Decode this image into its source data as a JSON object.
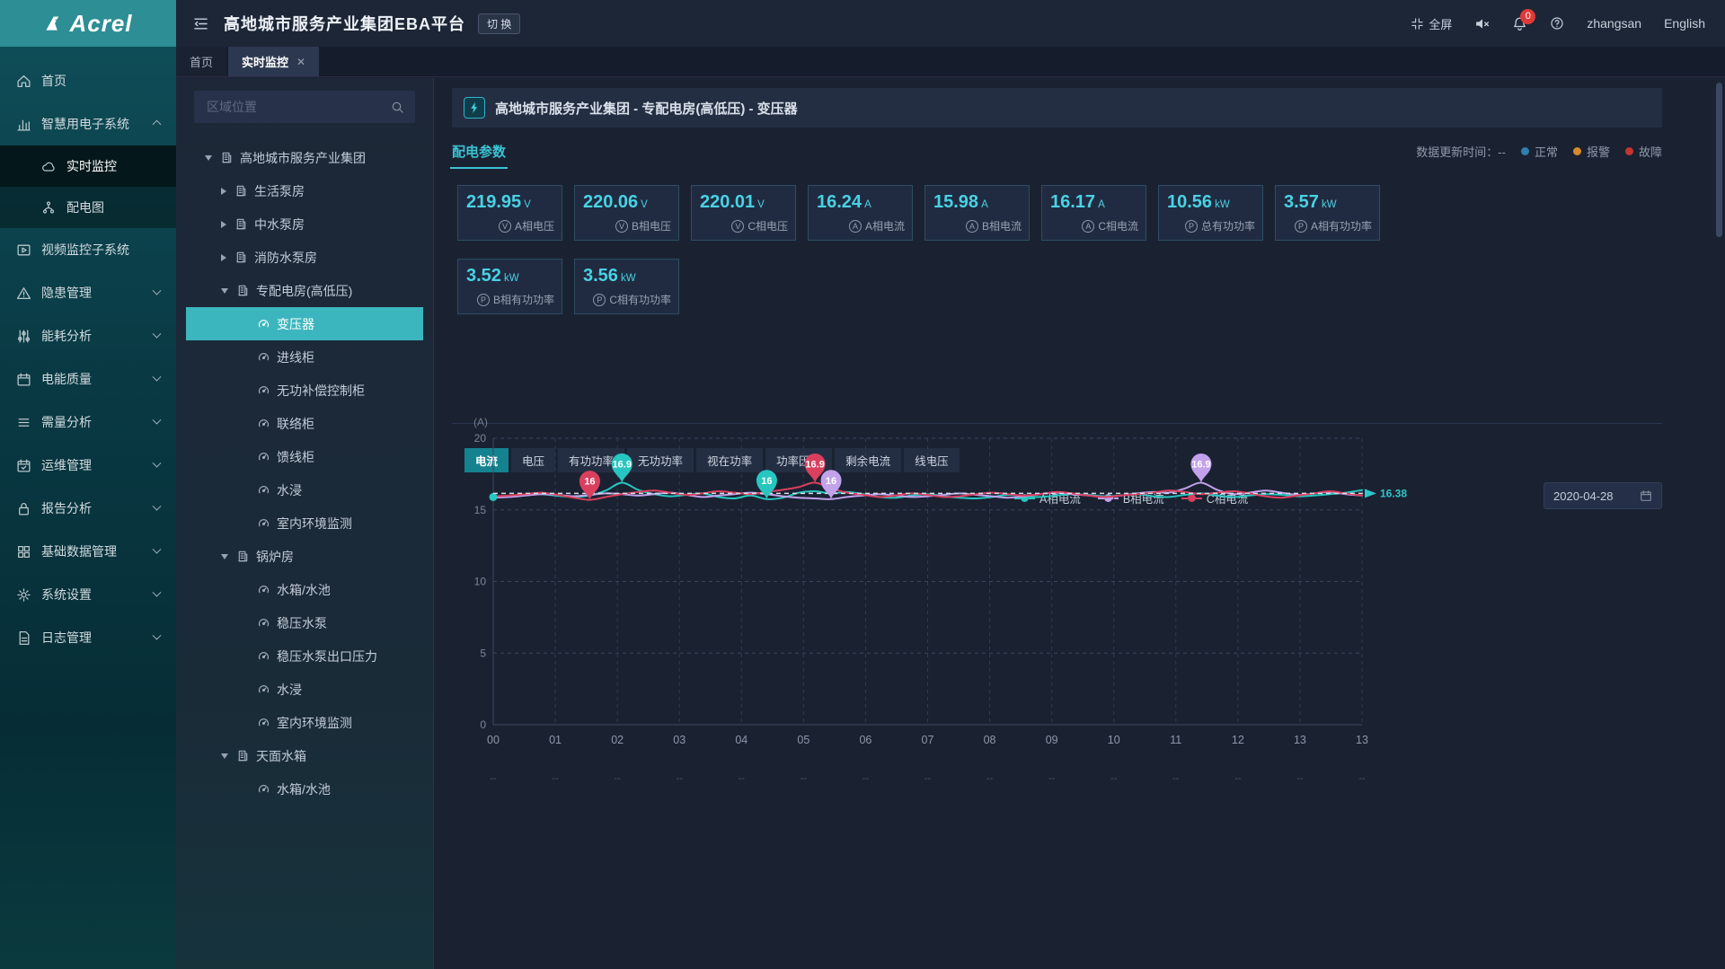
{
  "app": {
    "logo_text": "Acrel",
    "title": "高地城市服务产业集团EBA平台",
    "switch_button": "切 换"
  },
  "header": {
    "fullscreen_label": "全屏",
    "notification_count": "0",
    "username": "zhangsan",
    "language": "English"
  },
  "tabs": [
    {
      "label": "首页",
      "active": false,
      "closable": false
    },
    {
      "label": "实时监控",
      "active": true,
      "closable": true,
      "close_glyph": "✕"
    }
  ],
  "sidebar": {
    "items": [
      {
        "icon": "home",
        "label": "首页"
      },
      {
        "icon": "bar-chart",
        "label": "智慧用电子系统",
        "chevron": "up",
        "children": [
          {
            "icon": "cloud",
            "label": "实时监控",
            "active": true
          },
          {
            "icon": "branch",
            "label": "配电图"
          }
        ]
      },
      {
        "icon": "video",
        "label": "视频监控子系统"
      },
      {
        "icon": "warning",
        "label": "隐患管理",
        "chevron": "down"
      },
      {
        "icon": "sliders",
        "label": "能耗分析",
        "chevron": "down"
      },
      {
        "icon": "calendar",
        "label": "电能质量",
        "chevron": "down"
      },
      {
        "icon": "list",
        "label": "需量分析",
        "chevron": "down"
      },
      {
        "icon": "calendar-check",
        "label": "运维管理",
        "chevron": "down"
      },
      {
        "icon": "lock",
        "label": "报告分析",
        "chevron": "down"
      },
      {
        "icon": "grid",
        "label": "基础数据管理",
        "chevron": "down"
      },
      {
        "icon": "gear",
        "label": "系统设置",
        "chevron": "down"
      },
      {
        "icon": "file",
        "label": "日志管理",
        "chevron": "down"
      }
    ]
  },
  "tree": {
    "search_placeholder": "区域位置",
    "nodes": [
      {
        "level": 0,
        "caret": "down",
        "icon": "building",
        "label": "高地城市服务产业集团"
      },
      {
        "level": 1,
        "caret": "right",
        "icon": "building",
        "label": "生活泵房"
      },
      {
        "level": 1,
        "caret": "right",
        "icon": "building",
        "label": "中水泵房"
      },
      {
        "level": 1,
        "caret": "right",
        "icon": "building",
        "label": "消防水泵房"
      },
      {
        "level": 1,
        "caret": "down",
        "icon": "building",
        "label": "专配电房(高低压)"
      },
      {
        "level": 2,
        "icon": "gauge",
        "label": "变压器",
        "active": true
      },
      {
        "level": 2,
        "icon": "gauge",
        "label": "进线柜"
      },
      {
        "level": 2,
        "icon": "gauge",
        "label": "无功补偿控制柜"
      },
      {
        "level": 2,
        "icon": "gauge",
        "label": "联络柜"
      },
      {
        "level": 2,
        "icon": "gauge",
        "label": "馈线柜"
      },
      {
        "level": 2,
        "icon": "gauge",
        "label": "水浸"
      },
      {
        "level": 2,
        "icon": "gauge",
        "label": "室内环境监测"
      },
      {
        "level": 1,
        "caret": "down",
        "icon": "building",
        "label": "锅炉房"
      },
      {
        "level": 2,
        "icon": "gauge",
        "label": "水箱/水池"
      },
      {
        "level": 2,
        "icon": "gauge",
        "label": "稳压水泵"
      },
      {
        "level": 2,
        "icon": "gauge",
        "label": "稳压水泵出口压力"
      },
      {
        "level": 2,
        "icon": "gauge",
        "label": "水浸"
      },
      {
        "level": 2,
        "icon": "gauge",
        "label": "室内环境监测"
      },
      {
        "level": 1,
        "caret": "down",
        "icon": "building",
        "label": "天面水箱"
      },
      {
        "level": 2,
        "icon": "gauge",
        "label": "水箱/水池"
      }
    ]
  },
  "content": {
    "title": "高地城市服务产业集团 - 专配电房(高低压) - 变压器",
    "section_tab": "配电参数",
    "update_time_label": "数据更新时间：--",
    "status_legend": [
      {
        "label": "正常",
        "color": "#2f7fad"
      },
      {
        "label": "报警",
        "color": "#d78a2d"
      },
      {
        "label": "故障",
        "color": "#c43530"
      }
    ],
    "cards": [
      {
        "value": "219.95",
        "unit": "V",
        "badge": "V",
        "label": "A相电压"
      },
      {
        "value": "220.06",
        "unit": "V",
        "badge": "V",
        "label": "B相电压"
      },
      {
        "value": "220.01",
        "unit": "V",
        "badge": "V",
        "label": "C相电压"
      },
      {
        "value": "16.24",
        "unit": "A",
        "badge": "A",
        "label": "A相电流"
      },
      {
        "value": "15.98",
        "unit": "A",
        "badge": "A",
        "label": "B相电流"
      },
      {
        "value": "16.17",
        "unit": "A",
        "badge": "A",
        "label": "C相电流"
      },
      {
        "value": "10.56",
        "unit": "kW",
        "badge": "P",
        "label": "总有功功率"
      },
      {
        "value": "3.57",
        "unit": "kW",
        "badge": "P",
        "label": "A相有功功率"
      },
      {
        "value": "3.52",
        "unit": "kW",
        "badge": "P",
        "label": "B相有功功率"
      },
      {
        "value": "3.56",
        "unit": "kW",
        "badge": "P",
        "label": "C相有功功率"
      }
    ],
    "chart_tabs": [
      {
        "label": "电流",
        "active": true
      },
      {
        "label": "电压",
        "active": false
      },
      {
        "label": "有功功率",
        "active": false
      },
      {
        "label": "无功功率",
        "active": false
      },
      {
        "label": "视在功率",
        "active": false
      },
      {
        "label": "功率因数",
        "active": false
      },
      {
        "label": "剩余电流",
        "active": false
      },
      {
        "label": "线电压",
        "active": false
      }
    ],
    "date_value": "2020-04-28"
  },
  "chart_data": {
    "type": "line",
    "unit_label": "(A)",
    "ylim": [
      0,
      20
    ],
    "yticks": [
      0,
      5,
      10,
      15,
      20
    ],
    "x_labels": [
      "00",
      "01",
      "02",
      "03",
      "04",
      "05",
      "06",
      "07",
      "08",
      "09",
      "10",
      "11",
      "12",
      "13",
      "13"
    ],
    "x_sub_label": "--",
    "x_hours_span": 13.5,
    "grid": "dashed",
    "legend_position": "top",
    "avg_line": {
      "label": "16.38",
      "display_value": 16.15,
      "color": "#2ec7c9",
      "line_color": "#d5dde8"
    },
    "series": [
      {
        "name": "A相电流",
        "color": "#27c6c0",
        "values": [
          15.9,
          15.95,
          16.05,
          16.1,
          15.98,
          15.9,
          16.0,
          16.35,
          16.9,
          16.4,
          16.1,
          15.95,
          16.05,
          16.15,
          15.9,
          15.8,
          16.0,
          15.75,
          15.85,
          16.2,
          16.3,
          16.15,
          16.25,
          16.1,
          15.9,
          15.85,
          16.0,
          16.1,
          15.95,
          15.85,
          15.8,
          15.9,
          16.05,
          15.95,
          15.9,
          16.0,
          16.1,
          16.05,
          15.95,
          16.0,
          16.1,
          15.95,
          15.9,
          16.05,
          16.15,
          16.0,
          15.9,
          16.0,
          16.1,
          16.05,
          15.95,
          16.0,
          16.1,
          16.2,
          16.38
        ]
      },
      {
        "name": "B相电流",
        "color": "#c2a2ea",
        "values": [
          15.85,
          15.9,
          16.0,
          16.1,
          16.05,
          15.95,
          16.05,
          16.15,
          16.1,
          16.0,
          16.1,
          16.2,
          16.05,
          15.9,
          16.0,
          16.1,
          16.2,
          16.1,
          15.95,
          15.85,
          15.8,
          15.75,
          15.9,
          16.0,
          16.1,
          16.0,
          15.9,
          15.95,
          16.05,
          16.15,
          16.05,
          15.95,
          15.85,
          15.95,
          16.1,
          16.2,
          16.1,
          16.0,
          15.9,
          16.0,
          16.15,
          16.25,
          16.2,
          16.5,
          16.9,
          16.4,
          16.1,
          16.2,
          16.35,
          16.2,
          16.05,
          16.15,
          16.25,
          16.1,
          16.0
        ]
      },
      {
        "name": "C相电流",
        "color": "#da3f5e",
        "values": [
          15.95,
          16.0,
          16.1,
          16.2,
          16.05,
          15.85,
          15.7,
          15.9,
          16.1,
          16.25,
          16.35,
          16.2,
          16.05,
          16.15,
          16.3,
          16.2,
          16.1,
          16.25,
          16.4,
          16.6,
          16.9,
          16.5,
          16.2,
          16.05,
          15.9,
          16.0,
          16.15,
          16.05,
          15.9,
          15.95,
          16.1,
          16.2,
          16.1,
          16.0,
          16.1,
          16.25,
          16.15,
          16.0,
          15.9,
          16.0,
          16.1,
          16.2,
          16.35,
          16.25,
          16.1,
          16.2,
          16.3,
          16.15,
          15.95,
          15.85,
          16.0,
          16.15,
          16.3,
          16.15,
          16.0
        ]
      }
    ],
    "markers": [
      {
        "series": 2,
        "label": "16",
        "t": 1.5,
        "value": 15.7
      },
      {
        "series": 0,
        "label": "16.9",
        "t": 2.0,
        "value": 16.9
      },
      {
        "series": 0,
        "label": "16",
        "t": 4.25,
        "value": 15.75
      },
      {
        "series": 2,
        "label": "16.9",
        "t": 5.0,
        "value": 16.9
      },
      {
        "series": 1,
        "label": "16",
        "t": 5.25,
        "value": 15.75
      },
      {
        "series": 1,
        "label": "16.9",
        "t": 11.0,
        "value": 16.9
      }
    ]
  }
}
